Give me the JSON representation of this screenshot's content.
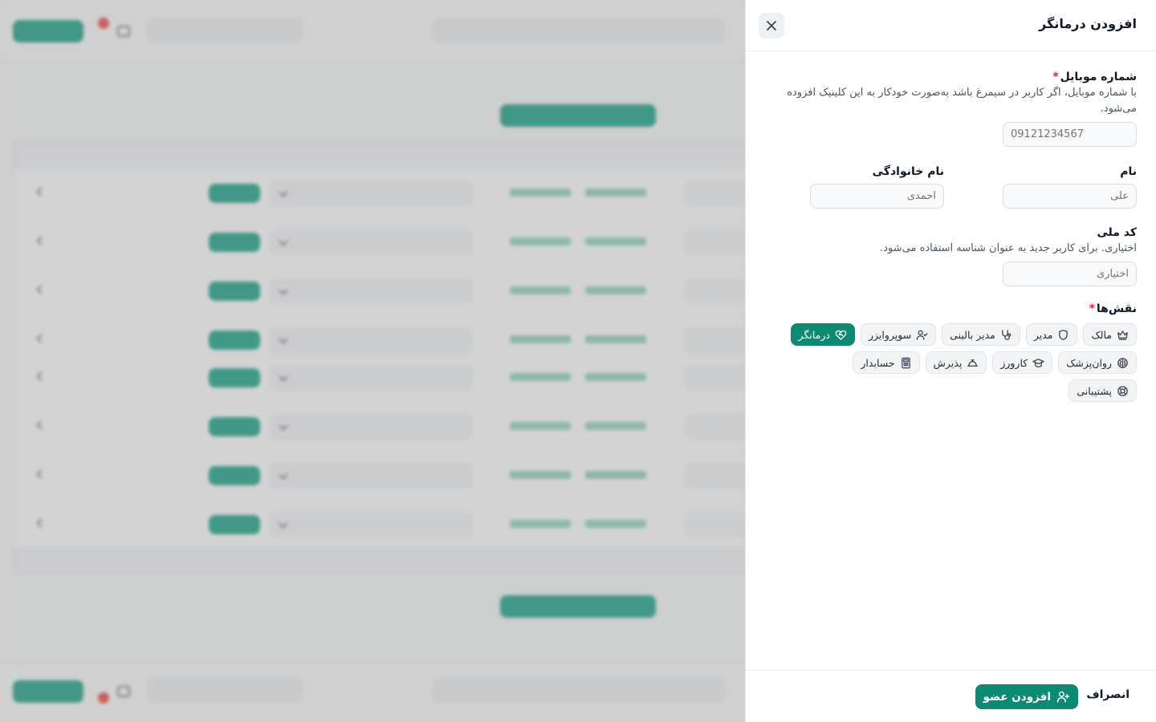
{
  "drawer": {
    "title": "افزودن درمانگر",
    "mobile": {
      "label": "شماره موبایل",
      "required_mark": "*",
      "hint": "با شماره موبایل، اگر کاربر در سیمرغ باشد به‌صورت خودکار به این کلینیک افزوده می‌شود.",
      "placeholder": "09121234567"
    },
    "first_name": {
      "label": "نام",
      "placeholder": "علی"
    },
    "last_name": {
      "label": "نام خانوادگی",
      "placeholder": "احمدی"
    },
    "national_id": {
      "label": "کد ملی",
      "hint": "اختیاری. برای کاربر جدید به عنوان شناسه استفاده می‌شود.",
      "placeholder": "اختیاری"
    },
    "roles": {
      "label": "نقش‌ها",
      "required_mark": "*",
      "items": [
        {
          "label": "مالک",
          "icon": "crown-icon",
          "active": false
        },
        {
          "label": "مدیر",
          "icon": "shield-icon",
          "active": false
        },
        {
          "label": "مدیر بالینی",
          "icon": "stethoscope-icon",
          "active": false
        },
        {
          "label": "سوپروایزر",
          "icon": "user-check-icon",
          "active": false
        },
        {
          "label": "درمانگر",
          "icon": "heart-handshake-icon",
          "active": true
        },
        {
          "label": "روان‌پزشک",
          "icon": "brain-icon",
          "active": false
        },
        {
          "label": "کارورز",
          "icon": "graduation-cap-icon",
          "active": false
        },
        {
          "label": "پذیرش",
          "icon": "bell-desk-icon",
          "active": false
        },
        {
          "label": "حسابدار",
          "icon": "calculator-icon",
          "active": false
        },
        {
          "label": "پشتیبانی",
          "icon": "life-buoy-icon",
          "active": false
        }
      ]
    },
    "footer": {
      "cancel_label": "انصراف",
      "submit_label": "افزودن عضو"
    }
  },
  "colors": {
    "accent": "#0e8a72",
    "required": "#e11d48"
  }
}
